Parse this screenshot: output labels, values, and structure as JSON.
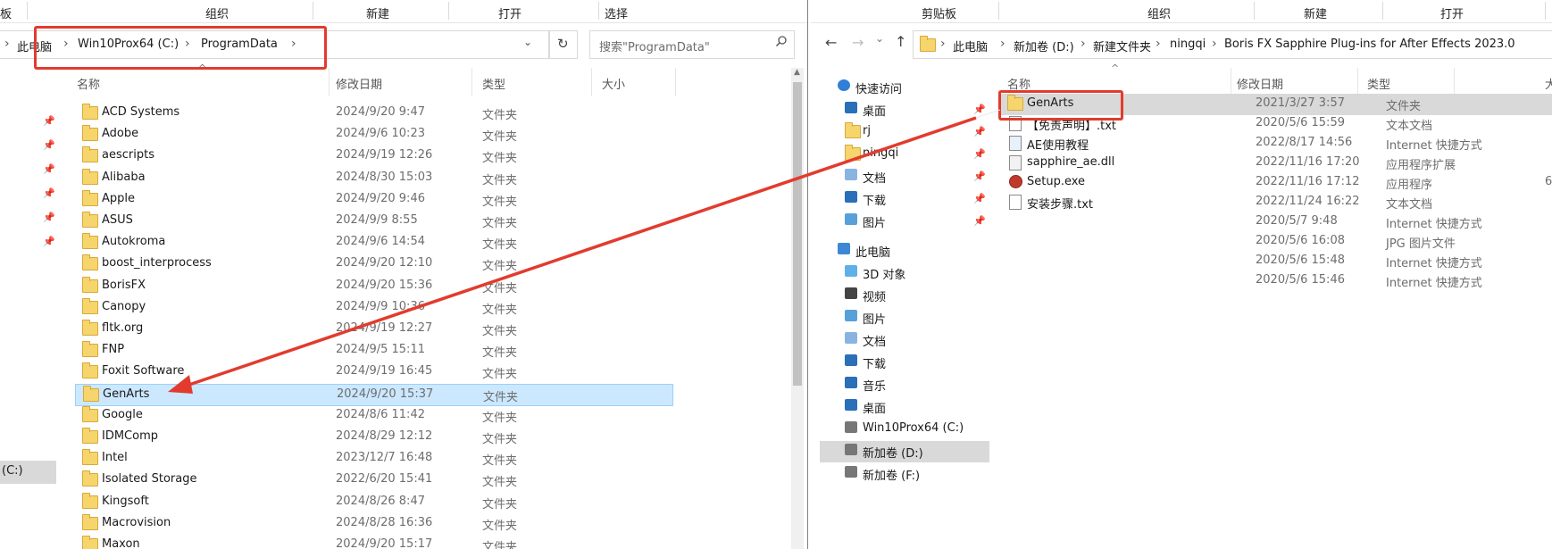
{
  "left": {
    "ribbon": [
      "板",
      "组织",
      "新建",
      "打开",
      "选择"
    ],
    "breadcrumb": [
      "此电脑",
      "Win10Prox64 (C:)",
      "ProgramData"
    ],
    "search_placeholder": "搜索\"ProgramData\"",
    "columns": {
      "name": "名称",
      "date": "修改日期",
      "type": "类型",
      "size": "大小"
    },
    "sidebar_drive": "(C:)",
    "rows": [
      {
        "name": "ACD Systems",
        "date": "2024/9/20 9:47",
        "type": "文件夹"
      },
      {
        "name": "Adobe",
        "date": "2024/9/6 10:23",
        "type": "文件夹"
      },
      {
        "name": "aescripts",
        "date": "2024/9/19 12:26",
        "type": "文件夹"
      },
      {
        "name": "Alibaba",
        "date": "2024/8/30 15:03",
        "type": "文件夹"
      },
      {
        "name": "Apple",
        "date": "2024/9/20 9:46",
        "type": "文件夹"
      },
      {
        "name": "ASUS",
        "date": "2024/9/9 8:55",
        "type": "文件夹"
      },
      {
        "name": "Autokroma",
        "date": "2024/9/6 14:54",
        "type": "文件夹"
      },
      {
        "name": "boost_interprocess",
        "date": "2024/9/20 12:10",
        "type": "文件夹"
      },
      {
        "name": "BorisFX",
        "date": "2024/9/20 15:36",
        "type": "文件夹"
      },
      {
        "name": "Canopy",
        "date": "2024/9/9 10:36",
        "type": "文件夹"
      },
      {
        "name": "fltk.org",
        "date": "2024/9/19 12:27",
        "type": "文件夹"
      },
      {
        "name": "FNP",
        "date": "2024/9/5 15:11",
        "type": "文件夹"
      },
      {
        "name": "Foxit Software",
        "date": "2024/9/19 16:45",
        "type": "文件夹"
      },
      {
        "name": "GenArts",
        "date": "2024/9/20 15:37",
        "type": "文件夹",
        "selected": true
      },
      {
        "name": "Google",
        "date": "2024/8/6 11:42",
        "type": "文件夹"
      },
      {
        "name": "IDMComp",
        "date": "2024/8/29 12:12",
        "type": "文件夹"
      },
      {
        "name": "Intel",
        "date": "2023/12/7 16:48",
        "type": "文件夹"
      },
      {
        "name": "Isolated Storage",
        "date": "2022/6/20 15:41",
        "type": "文件夹"
      },
      {
        "name": "Kingsoft",
        "date": "2024/8/26 8:47",
        "type": "文件夹"
      },
      {
        "name": "Macrovision",
        "date": "2024/8/28 16:36",
        "type": "文件夹"
      },
      {
        "name": "Maxon",
        "date": "2024/9/20 15:17",
        "type": "文件夹"
      }
    ]
  },
  "right": {
    "ribbon": [
      "剪贴板",
      "组织",
      "新建",
      "打开"
    ],
    "breadcrumb": [
      "此电脑",
      "新加卷 (D:)",
      "新建文件夹",
      "ningqi",
      "Boris FX Sapphire Plug-ins for After Effects 2023.0"
    ],
    "columns": {
      "name": "名称",
      "date": "修改日期",
      "type": "类型",
      "size": "大"
    },
    "nav": [
      {
        "label": "快速访问",
        "icon": "star-icon",
        "level": 0,
        "pinned": false
      },
      {
        "label": "桌面",
        "icon": "desktop-icon",
        "level": 1,
        "pinned": true
      },
      {
        "label": "rj",
        "icon": "folder-icon",
        "level": 1,
        "pinned": true
      },
      {
        "label": "ningqi",
        "icon": "folder-icon",
        "level": 1,
        "pinned": true
      },
      {
        "label": "文档",
        "icon": "document-icon",
        "level": 1,
        "pinned": true
      },
      {
        "label": "下载",
        "icon": "download-icon",
        "level": 1,
        "pinned": true
      },
      {
        "label": "图片",
        "icon": "picture-icon",
        "level": 1,
        "pinned": true
      },
      {
        "label": "此电脑",
        "icon": "computer-icon",
        "level": 0,
        "pinned": false
      },
      {
        "label": "3D 对象",
        "icon": "3d-objects-icon",
        "level": 1,
        "pinned": false
      },
      {
        "label": "视频",
        "icon": "video-icon",
        "level": 1,
        "pinned": false
      },
      {
        "label": "图片",
        "icon": "picture-icon",
        "level": 1,
        "pinned": false
      },
      {
        "label": "文档",
        "icon": "document-icon",
        "level": 1,
        "pinned": false
      },
      {
        "label": "下载",
        "icon": "download-icon",
        "level": 1,
        "pinned": false
      },
      {
        "label": "音乐",
        "icon": "music-icon",
        "level": 1,
        "pinned": false
      },
      {
        "label": "桌面",
        "icon": "desktop-icon",
        "level": 1,
        "pinned": false
      },
      {
        "label": "Win10Prox64 (C:)",
        "icon": "drive-icon",
        "level": 1,
        "pinned": false
      },
      {
        "label": "新加卷 (D:)",
        "icon": "drive-icon",
        "level": 1,
        "pinned": false,
        "selected": true
      },
      {
        "label": "新加卷 (F:)",
        "icon": "drive-icon",
        "level": 1,
        "pinned": false
      }
    ],
    "rows": [
      {
        "name": "GenArts",
        "date": "2021/3/27 3:57",
        "type": "文件夹",
        "size": "",
        "icon": "folder-icon",
        "selected": true
      },
      {
        "name": "【免责声明】.txt",
        "date": "2020/5/6 15:59",
        "type": "文本文档",
        "size": "",
        "icon": "text-file-icon"
      },
      {
        "name": "AE使用教程",
        "date": "2022/8/17 14:56",
        "type": "Internet 快捷方式",
        "size": "",
        "icon": "shortcut-icon"
      },
      {
        "name": "sapphire_ae.dll",
        "date": "2022/11/16 17:20",
        "type": "应用程序扩展",
        "size": "",
        "icon": "dll-icon"
      },
      {
        "name": "Setup.exe",
        "date": "2022/11/16 17:12",
        "type": "应用程序",
        "size": "6",
        "icon": "setup-icon"
      },
      {
        "name": "安装步骤.txt",
        "date": "2022/11/24 16:22",
        "type": "文本文档",
        "size": "",
        "icon": "text-file-icon"
      },
      {
        "name": "",
        "date": "2020/5/7 9:48",
        "type": "Internet 快捷方式",
        "size": "",
        "icon": ""
      },
      {
        "name": "",
        "date": "2020/5/6 16:08",
        "type": "JPG 图片文件",
        "size": "",
        "icon": ""
      },
      {
        "name": "",
        "date": "2020/5/6 15:48",
        "type": "Internet 快捷方式",
        "size": "",
        "icon": ""
      },
      {
        "name": "",
        "date": "2020/5/6 15:46",
        "type": "Internet 快捷方式",
        "size": "",
        "icon": ""
      }
    ]
  },
  "colors": {
    "accent_red": "#e23b2e",
    "selection": "#cce8ff",
    "selection_border": "#99d1ff",
    "grey_selection": "#d9d9d9"
  }
}
